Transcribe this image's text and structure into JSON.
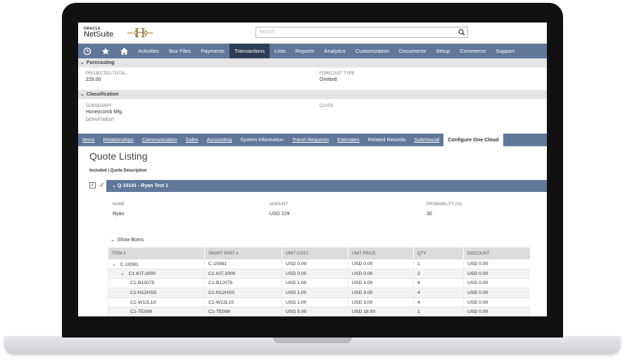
{
  "header": {
    "brand_top": "ORACLE",
    "brand_name": "NetSuite",
    "search_placeholder": "Search"
  },
  "nav": {
    "icons": [
      "recent-icon",
      "star-icon",
      "home-icon"
    ],
    "items": [
      {
        "label": "Activities"
      },
      {
        "label": "Box Files"
      },
      {
        "label": "Payments"
      },
      {
        "label": "Transactions",
        "active": true
      },
      {
        "label": "Lists"
      },
      {
        "label": "Reports"
      },
      {
        "label": "Analytics"
      },
      {
        "label": "Customization"
      },
      {
        "label": "Documents"
      },
      {
        "label": "Setup"
      },
      {
        "label": "Commerce"
      },
      {
        "label": "Support"
      }
    ]
  },
  "forecasting": {
    "title": "Forecasting",
    "projected_total_label": "PROJECTED TOTAL",
    "projected_total_value": "229.00",
    "forecast_type_label": "FORECAST TYPE",
    "forecast_type_value": "Omitted"
  },
  "classification": {
    "title": "Classification",
    "subsidiary_label": "SUBSIDIARY",
    "subsidiary_value": "Honeycomb Mfg.",
    "class_label": "CLASS",
    "department_label": "DEPARTMENT"
  },
  "subtabs": [
    {
      "label": "Items"
    },
    {
      "label": "Relationships"
    },
    {
      "label": "Communication"
    },
    {
      "label": "Sales"
    },
    {
      "label": "Accounting"
    },
    {
      "label": "System Information"
    },
    {
      "label": "Travel Requests"
    },
    {
      "label": "Estimates"
    },
    {
      "label": "Related Records"
    },
    {
      "label": "SuiteSocial"
    },
    {
      "label": "Configure One Cloud",
      "active": true
    }
  ],
  "quote": {
    "title": "Quote Listing",
    "subtitle": "Included | Quote Description",
    "bar_label": "Q-10141 - Ryan Test 1",
    "name_label": "NAME",
    "name_value": "Ryan",
    "amount_label": "AMOUNT",
    "amount_value": "USD 229",
    "probability_label": "PROBABILITY (%)",
    "probability_value": "30",
    "show_boms": "Show Boms"
  },
  "boms": {
    "columns": [
      "ITEM #",
      "SMART PART #",
      "UNIT COST",
      "UNIT PRICE",
      "QTY",
      "DISCOUNT"
    ],
    "rows": [
      {
        "indent": 0,
        "toggle": "⌄",
        "item": "C-10081",
        "smart": "C-10081",
        "cost": "USD 0.00",
        "price": "USD 0.00",
        "qty": "1",
        "discount": "USD 0.00"
      },
      {
        "indent": 1,
        "toggle": "⌄",
        "item": "C1-KIT-2000",
        "smart": "C1-KIT-2000",
        "cost": "USD 0.00",
        "price": "USD 0.00",
        "qty": "2",
        "discount": "USD 0.00"
      },
      {
        "indent": 2,
        "toggle": "",
        "item": "C1-B12075",
        "smart": "C1-B12075",
        "cost": "USD 1.00",
        "price": "USD 3.00",
        "qty": "4",
        "discount": "USD 0.00"
      },
      {
        "indent": 2,
        "toggle": "",
        "item": "C1-N12HSS",
        "smart": "C1-N12HSS",
        "cost": "USD 1.00",
        "price": "USD 3.00",
        "qty": "4",
        "discount": "USD 0.00"
      },
      {
        "indent": 2,
        "toggle": "",
        "item": "C1-W12L10",
        "smart": "C1-W12L10",
        "cost": "USD 1.00",
        "price": "USD 3.00",
        "qty": "4",
        "discount": "USD 0.00"
      },
      {
        "indent": 1,
        "toggle": "",
        "item": "C1-TE098",
        "smart": "C1-TE098",
        "cost": "USD 5.00",
        "price": "USD 18.00",
        "qty": "1",
        "discount": "USD 0.00"
      }
    ]
  }
}
